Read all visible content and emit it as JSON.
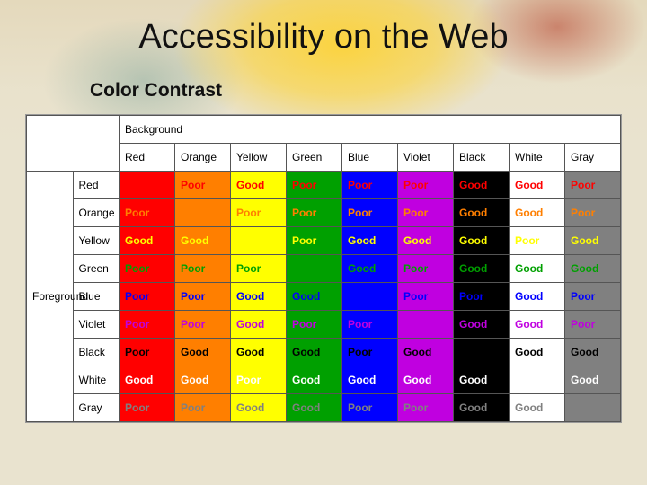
{
  "title": "Accessibility on the Web",
  "subtitle": "Color Contrast",
  "chart_data": {
    "type": "table",
    "title": "Color Contrast — Foreground vs Background",
    "bg_header": "Background",
    "fg_header": "Foreground",
    "colors": [
      "Red",
      "Orange",
      "Yellow",
      "Green",
      "Blue",
      "Violet",
      "Black",
      "White",
      "Gray"
    ],
    "palette": {
      "Red": "#ff0000",
      "Orange": "#ff7f00",
      "Yellow": "#ffff00",
      "Green": "#00a000",
      "Blue": "#0000ff",
      "Violet": "#c000e0",
      "Black": "#000000",
      "White": "#ffffff",
      "Gray": "#808080"
    },
    "grid": [
      [
        "",
        "Poor",
        "Good",
        "Poor",
        "Poor",
        "Poor",
        "Good",
        "Good",
        "Poor"
      ],
      [
        "Poor",
        "",
        "Poor",
        "Poor",
        "Poor",
        "Poor",
        "Good",
        "Good",
        "Poor"
      ],
      [
        "Good",
        "Good",
        "",
        "Poor",
        "Good",
        "Good",
        "Good",
        "Poor",
        "Good"
      ],
      [
        "Poor",
        "Poor",
        "Poor",
        "",
        "Good",
        "Poor",
        "Good",
        "Good",
        "Good"
      ],
      [
        "Poor",
        "Poor",
        "Good",
        "Good",
        "",
        "Poor",
        "Poor",
        "Good",
        "Poor"
      ],
      [
        "Poor",
        "Poor",
        "Good",
        "Poor",
        "Poor",
        "",
        "Good",
        "Good",
        "Poor"
      ],
      [
        "Poor",
        "Good",
        "Good",
        "Good",
        "Poor",
        "Good",
        "",
        "Good",
        "Good"
      ],
      [
        "Good",
        "Good",
        "Poor",
        "Good",
        "Good",
        "Good",
        "Good",
        "",
        "Good"
      ],
      [
        "Poor",
        "Poor",
        "Good",
        "Good",
        "Poor",
        "Poor",
        "Good",
        "Good",
        ""
      ]
    ]
  }
}
